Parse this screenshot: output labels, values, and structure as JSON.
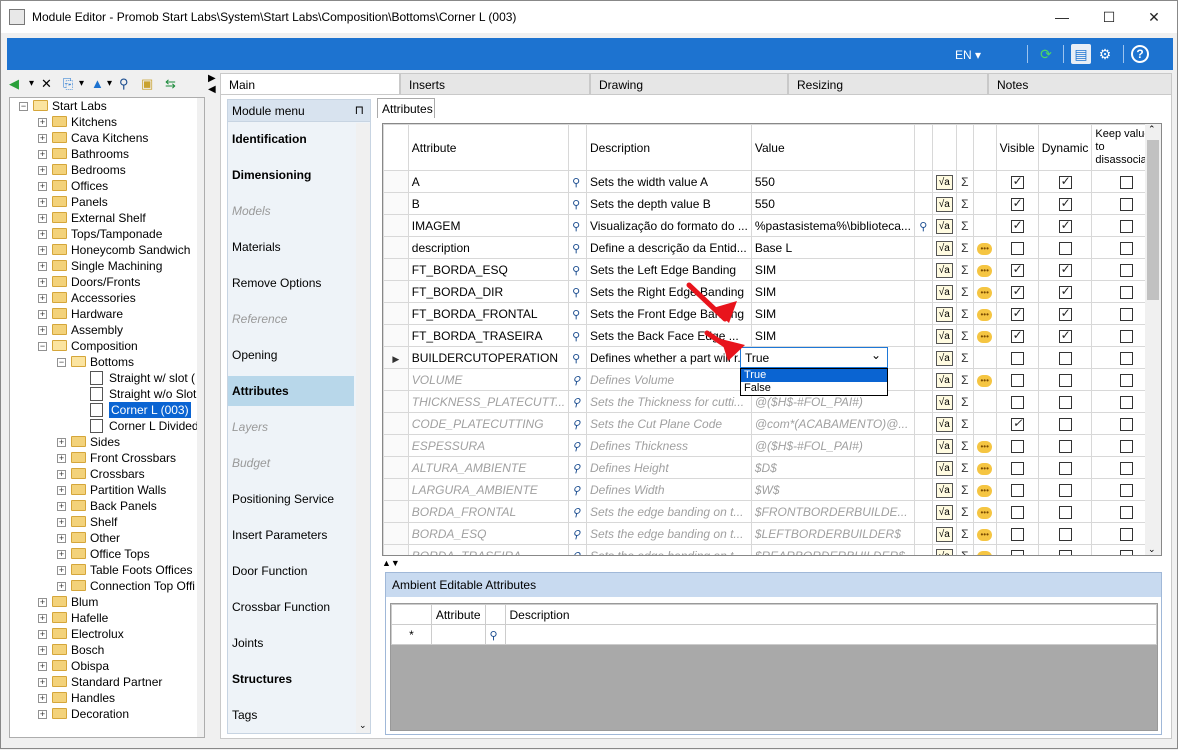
{
  "window": {
    "title": "Module Editor - Promob Start Labs\\System\\Start Labs\\Composition\\Bottoms\\Corner L (003)",
    "minimize": "—",
    "maximize": "☐",
    "close": "✕"
  },
  "toolbar": {
    "language": "EN",
    "language_caret": "▾",
    "refresh_icon": "⟳",
    "layout_icon": "▤",
    "settings_icon": "⚙",
    "help_icon": "?"
  },
  "left_toolbar": {
    "back_icon": "◀",
    "delete_icon": "✕",
    "copy_icon": "⎘",
    "up_icon": "▲",
    "find_icon": "⚲",
    "folder_icon": "▣",
    "link_icon": "⇆"
  },
  "tree": {
    "root": "Start Labs",
    "items": [
      "Kitchens",
      "Cava Kitchens",
      "Bathrooms",
      "Bedrooms",
      "Offices",
      "Panels",
      "External Shelf",
      "Tops/Tamponade",
      "Honeycomb Sandwich",
      "Single Machining",
      "Doors/Fronts",
      "Accessories",
      "Hardware",
      "Assembly"
    ],
    "composition": "Composition",
    "bottoms": "Bottoms",
    "bottom_children": [
      "Straight w/ slot (",
      "Straight w/o Slot",
      "Corner L (003)",
      "Corner L Divided"
    ],
    "composition_children": [
      "Sides",
      "Front Crossbars",
      "Crossbars",
      "Partition Walls",
      "Back Panels",
      "Shelf",
      "Other",
      "Office Tops",
      "Table Foots Offices",
      "Connection Top Offi"
    ],
    "after": [
      "Blum",
      "Hafelle",
      "Electrolux",
      "Bosch",
      "Obispa",
      "Standard Partner",
      "Handles",
      "Decoration"
    ]
  },
  "tabs": [
    "Main",
    "Inserts",
    "Drawing",
    "Resizing",
    "Notes"
  ],
  "module_menu": {
    "header": "Module menu",
    "pin": "⊓",
    "items": [
      {
        "label": "Identification",
        "style": "b"
      },
      {
        "label": "Dimensioning",
        "style": "b"
      },
      {
        "label": "Models",
        "style": "d"
      },
      {
        "label": "Materials",
        "style": ""
      },
      {
        "label": "Remove Options",
        "style": ""
      },
      {
        "label": "Reference",
        "style": "d"
      },
      {
        "label": "Opening",
        "style": ""
      },
      {
        "label": "Attributes",
        "style": "b active"
      },
      {
        "label": "Layers",
        "style": "d"
      },
      {
        "label": "Budget",
        "style": "d"
      },
      {
        "label": "Positioning Service",
        "style": ""
      },
      {
        "label": "Insert Parameters",
        "style": ""
      },
      {
        "label": "Door Function",
        "style": ""
      },
      {
        "label": "Crossbar Function",
        "style": ""
      },
      {
        "label": "Joints",
        "style": ""
      },
      {
        "label": "Structures",
        "style": "b"
      },
      {
        "label": "Tags",
        "style": ""
      }
    ]
  },
  "attributes_tab": "Attributes",
  "grid": {
    "headers": {
      "attribute": "Attribute",
      "description": "Description",
      "value": "Value",
      "visible": "Visible",
      "dynamic": "Dynamic",
      "keep": "Keep value to disassociate"
    },
    "rows": [
      {
        "attr": "A",
        "desc": "Sets the width value A",
        "value": "550",
        "vb": "",
        "bub": "",
        "vis": true,
        "dyn": true,
        "keep": false,
        "inh": false
      },
      {
        "attr": "B",
        "desc": "Sets the depth value B",
        "value": "550",
        "vb": "",
        "bub": "",
        "vis": true,
        "dyn": true,
        "keep": false,
        "inh": false
      },
      {
        "attr": "IMAGEM",
        "desc": "Visualização do formato do ...",
        "value": "%pastasistema%\\biblioteca...",
        "vb": "binoculars",
        "bub": "",
        "vis": true,
        "dyn": true,
        "keep": false,
        "inh": false
      },
      {
        "attr": "description",
        "desc": "Define a descrição da Entid...",
        "value": "Base L",
        "vb": "",
        "bub": "speech",
        "vis": false,
        "dyn": false,
        "keep": false,
        "inh": false
      },
      {
        "attr": "FT_BORDA_ESQ",
        "desc": "Sets the Left Edge Banding",
        "value": "SIM",
        "vb": "",
        "bub": "speech",
        "vis": true,
        "dyn": true,
        "keep": false,
        "inh": false
      },
      {
        "attr": "FT_BORDA_DIR",
        "desc": "Sets the Right Edge Banding",
        "value": "SIM",
        "vb": "",
        "bub": "speech",
        "vis": true,
        "dyn": true,
        "keep": false,
        "inh": false
      },
      {
        "attr": "FT_BORDA_FRONTAL",
        "desc": "Sets the Front Edge Banding",
        "value": "SIM",
        "vb": "",
        "bub": "speech",
        "vis": true,
        "dyn": true,
        "keep": false,
        "inh": false
      },
      {
        "attr": "FT_BORDA_TRASEIRA",
        "desc": "Sets the Back Face Edge ...",
        "value": "SIM",
        "vb": "",
        "bub": "speech",
        "vis": true,
        "dyn": true,
        "keep": false,
        "inh": false
      },
      {
        "attr": "BUILDERCUTOPERATION",
        "desc": "Defines whether a part will r...",
        "value": "",
        "vb": "",
        "bub": "",
        "vis": false,
        "dyn": false,
        "keep": false,
        "inh": false,
        "current": true
      },
      {
        "attr": "VOLUME",
        "desc": "Defines Volume",
        "value": "",
        "vb": "",
        "bub": "speech",
        "vis": false,
        "dyn": false,
        "keep": false,
        "inh": true
      },
      {
        "attr": "THICKNESS_PLATECUTT...",
        "desc": "Sets the Thickness for cutti...",
        "value": "@($H$-#FOL_PAI#)",
        "vb": "",
        "bub": "",
        "vis": false,
        "dyn": false,
        "keep": false,
        "inh": true
      },
      {
        "attr": "CODE_PLATECUTTING",
        "desc": "Sets the Cut Plane Code",
        "value": "@com*(ACABAMENTO)@...",
        "vb": "",
        "bub": "",
        "vis": true,
        "dyn": false,
        "keep": false,
        "inh": true
      },
      {
        "attr": "ESPESSURA",
        "desc": "Defines Thickness",
        "value": "@($H$-#FOL_PAI#)",
        "vb": "",
        "bub": "speech",
        "vis": false,
        "dyn": false,
        "keep": false,
        "inh": true
      },
      {
        "attr": "ALTURA_AMBIENTE",
        "desc": "Defines Height",
        "value": "$D$",
        "vb": "",
        "bub": "speech",
        "vis": false,
        "dyn": false,
        "keep": false,
        "inh": true
      },
      {
        "attr": "LARGURA_AMBIENTE",
        "desc": "Defines Width",
        "value": "$W$",
        "vb": "",
        "bub": "speech",
        "vis": false,
        "dyn": false,
        "keep": false,
        "inh": true
      },
      {
        "attr": "BORDA_FRONTAL",
        "desc": "Sets the edge banding on t...",
        "value": "$FRONTBORDERBUILDE...",
        "vb": "",
        "bub": "speech",
        "vis": false,
        "dyn": false,
        "keep": false,
        "inh": true
      },
      {
        "attr": "BORDA_ESQ",
        "desc": "Sets the edge banding on t...",
        "value": "$LEFTBORDERBUILDER$",
        "vb": "",
        "bub": "speech",
        "vis": false,
        "dyn": false,
        "keep": false,
        "inh": true
      },
      {
        "attr": "BORDA_TRASEIRA",
        "desc": "Sets the edge banding on t...",
        "value": "$REARBORDERBUILDER$",
        "vb": "",
        "bub": "speech",
        "vis": false,
        "dyn": false,
        "keep": false,
        "inh": true
      }
    ]
  },
  "dropdown": {
    "value": "True",
    "caret": "⌄",
    "options": [
      "True",
      "False"
    ]
  },
  "sort_arrows": "▲▼",
  "ambient": {
    "title": "Ambient Editable Attributes",
    "col_attribute": "Attribute",
    "col_description": "Description",
    "new_row_marker": "*"
  },
  "colors": {
    "accent": "#1d73d0",
    "selection": "#0a64d2",
    "menu_active": "#b8d7ea",
    "arrow": "#e8141c"
  }
}
